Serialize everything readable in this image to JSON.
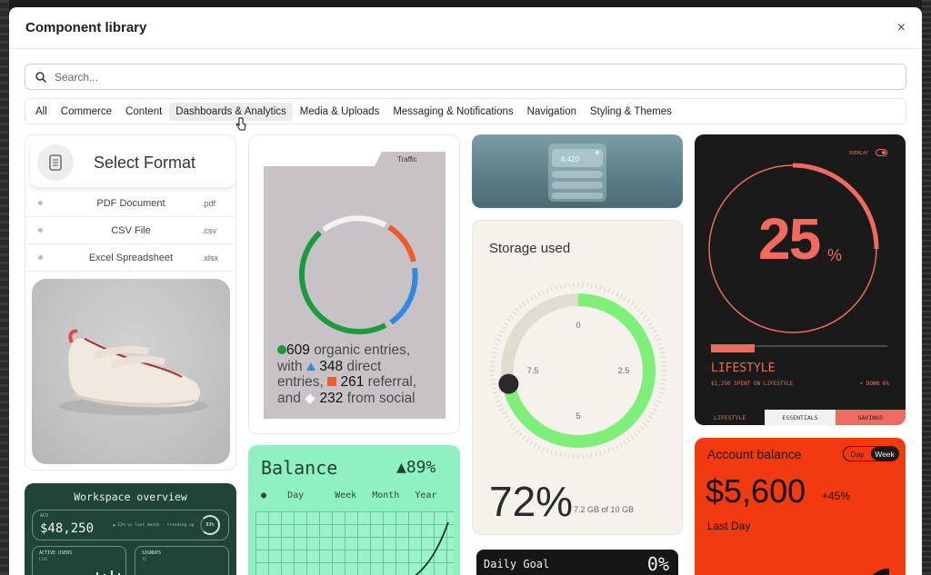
{
  "modal": {
    "title": "Component library",
    "close_label": "×"
  },
  "search": {
    "placeholder": "Search..."
  },
  "tabs": [
    {
      "label": "All"
    },
    {
      "label": "Commerce"
    },
    {
      "label": "Content"
    },
    {
      "label": "Dashboards & Analytics",
      "active": true
    },
    {
      "label": "Media & Uploads"
    },
    {
      "label": "Messaging & Notifications"
    },
    {
      "label": "Navigation"
    },
    {
      "label": "Styling & Themes"
    }
  ],
  "select_format": {
    "title": "Select Format",
    "options": [
      {
        "name": "PDF Document",
        "ext": ".pdf"
      },
      {
        "name": "CSV File",
        "ext": ".csv"
      },
      {
        "name": "Excel Spreadsheet",
        "ext": ".xlsx"
      }
    ]
  },
  "workspace": {
    "title": "Workspace overview",
    "amount_label": "ACV",
    "amount": "$48,250",
    "delta": "▲ 12% vs last month · trending up",
    "ring_value": "83%",
    "mini1_label": "ACTIVE USERS",
    "mini1_sub": "LIVE",
    "mini2_label": "SIGNUPS",
    "mini2_sub": "7D"
  },
  "traffic": {
    "tab_label": "Traffic",
    "organic": "609",
    "organic_text": "organic entries,",
    "direct_prefix": "with",
    "direct": "348",
    "direct_text": "direct",
    "referral_prefix": "entries,",
    "referral": "261",
    "referral_text": "referral,",
    "social_prefix": "and",
    "social": "232",
    "social_text": "from social"
  },
  "balance": {
    "title": "Balance",
    "pct": "▲89%",
    "tabs": [
      "Day",
      "Week",
      "Month",
      "Year"
    ],
    "active_tab_marker": "●"
  },
  "glass": {
    "value": "8,420"
  },
  "storage": {
    "title": "Storage used",
    "ticks": [
      "0",
      "2.5",
      "5",
      "7.5"
    ],
    "value": "72%",
    "sub": "7.2 GB of 10 GB",
    "progress": 0.72
  },
  "daily_goal": {
    "title": "Daily Goal",
    "value": "0%"
  },
  "lifestyle": {
    "overlay_label": "OVERLAY",
    "pct": "25",
    "pct_sym": "%",
    "name": "LIFESTYLE",
    "spent": "$1,250 SPENT ON LIFESTYLE",
    "down": "▾ DOWN 6%",
    "tabs": [
      "LIFESTYLE",
      "ESSENTIALS",
      "SAVINGS"
    ],
    "progress": 0.25
  },
  "account": {
    "title": "Account balance",
    "toggle_day": "Day",
    "toggle_week": "Week",
    "amount": "$5,600",
    "delta": "+45%",
    "period": "Last Day"
  },
  "colors": {
    "traffic_green": "#1c9b3e",
    "traffic_blue": "#2f8be0",
    "traffic_orange": "#ef5b2f",
    "storage_green": "#7ef07a",
    "lifestyle_red": "#f06a5f",
    "account_red": "#f23a10",
    "balance_green": "#8ff0c0"
  }
}
